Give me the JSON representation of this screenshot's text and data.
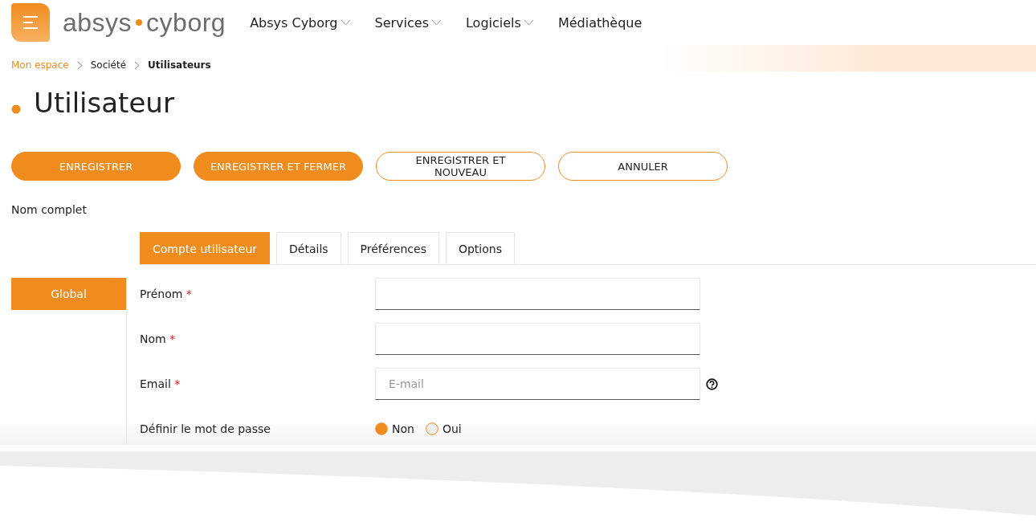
{
  "header": {
    "logo": {
      "left": "absys",
      "right": "cyborg"
    },
    "nav": [
      {
        "label": "Absys Cyborg",
        "dropdown": true
      },
      {
        "label": "Services",
        "dropdown": true
      },
      {
        "label": "Logiciels",
        "dropdown": true
      },
      {
        "label": "Médiathèque",
        "dropdown": false
      }
    ]
  },
  "breadcrumb": [
    {
      "label": "Mon espace",
      "kind": "link"
    },
    {
      "label": "Société",
      "kind": "plain"
    },
    {
      "label": "Utilisateurs",
      "kind": "current"
    }
  ],
  "title": "Utilisateur",
  "buttons": [
    {
      "label": "ENREGISTRER",
      "kind": "filled"
    },
    {
      "label": "ENREGISTRER ET FERMER",
      "kind": "filled"
    },
    {
      "label": "ENREGISTRER ET NOUVEAU",
      "kind": "outline"
    },
    {
      "label": "ANNULER",
      "kind": "outline"
    }
  ],
  "full_name_label": "Nom complet",
  "tabs": [
    {
      "label": "Compte utilisateur",
      "selected": true
    },
    {
      "label": "Détails",
      "selected": false
    },
    {
      "label": "Préférences",
      "selected": false
    },
    {
      "label": "Options",
      "selected": false
    }
  ],
  "sidebar": {
    "items": [
      {
        "label": "Global",
        "selected": true
      }
    ]
  },
  "form": [
    {
      "kind": "text",
      "label": "Prénom",
      "required_mark": "*"
    },
    {
      "kind": "text",
      "label": "Nom",
      "required_mark": "*"
    },
    {
      "kind": "text",
      "label": "Email",
      "required_mark": "*",
      "placeholder": "E-mail",
      "help": true
    },
    {
      "kind": "radio",
      "label": "Définir le mot de passe",
      "options": [
        {
          "label": "Non",
          "selected": true
        },
        {
          "label": "Oui",
          "selected": false
        }
      ]
    }
  ]
}
